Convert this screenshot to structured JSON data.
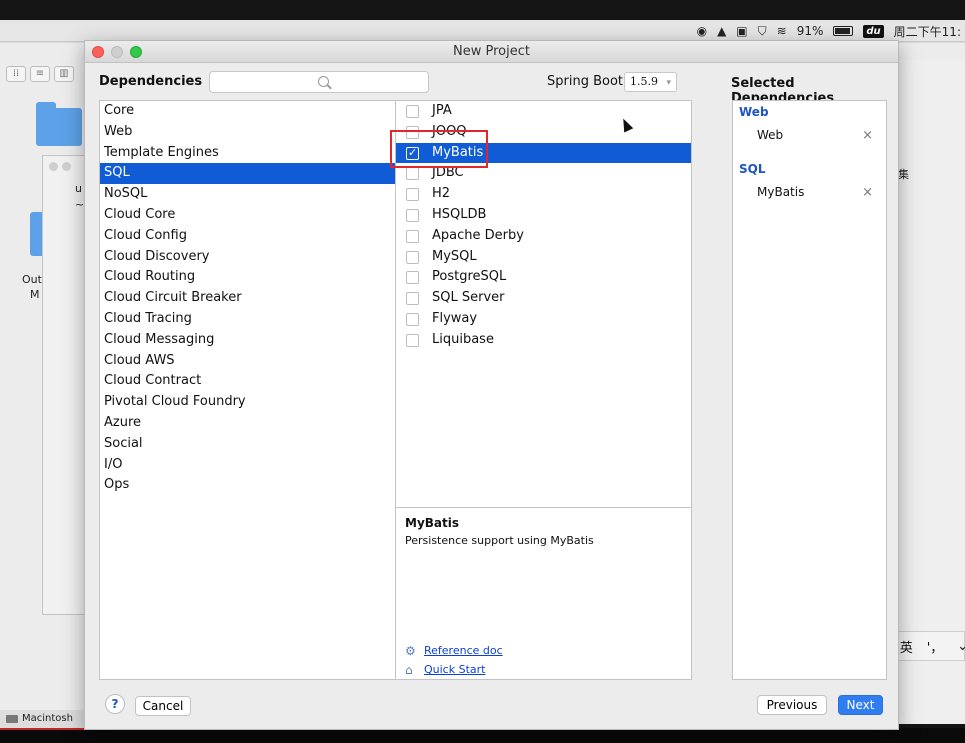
{
  "menubar": {
    "battery": "91%",
    "ime_badge": "du",
    "clock": "周二下午11:"
  },
  "desktop": {
    "window_text_1": "u",
    "window_text_2": "~",
    "folder_label_1": "Out",
    "folder_label_2": "M",
    "right_text": "集",
    "dock_label": "Macintosh",
    "ime_logo": "du",
    "ime_lang": "英",
    "ime_punct": "'，",
    "ime_extra": "⌄"
  },
  "dialog": {
    "title": "New Project",
    "dependencies_title": "Dependencies",
    "search_placeholder": "",
    "spring_boot_label": "Spring Boot",
    "spring_boot_version": "1.5.9",
    "selected_title": "Selected Dependencies",
    "categories": [
      "Core",
      "Web",
      "Template Engines",
      "SQL",
      "NoSQL",
      "Cloud Core",
      "Cloud Config",
      "Cloud Discovery",
      "Cloud Routing",
      "Cloud Circuit Breaker",
      "Cloud Tracing",
      "Cloud Messaging",
      "Cloud AWS",
      "Cloud Contract",
      "Pivotal Cloud Foundry",
      "Azure",
      "Social",
      "I/O",
      "Ops"
    ],
    "selected_category": "SQL",
    "dependencies": [
      {
        "label": "JPA",
        "checked": false
      },
      {
        "label": "JOOQ",
        "checked": false
      },
      {
        "label": "MyBatis",
        "checked": true
      },
      {
        "label": "JDBC",
        "checked": false
      },
      {
        "label": "H2",
        "checked": false
      },
      {
        "label": "HSQLDB",
        "checked": false
      },
      {
        "label": "Apache Derby",
        "checked": false
      },
      {
        "label": "MySQL",
        "checked": false
      },
      {
        "label": "PostgreSQL",
        "checked": false
      },
      {
        "label": "SQL Server",
        "checked": false
      },
      {
        "label": "Flyway",
        "checked": false
      },
      {
        "label": "Liquibase",
        "checked": false
      }
    ],
    "description": {
      "name": "MyBatis",
      "text": "Persistence support using MyBatis",
      "reference_link": "Reference doc",
      "quickstart_link": "Quick Start"
    },
    "selected": [
      {
        "group": "Web",
        "items": [
          "Web"
        ]
      },
      {
        "group": "SQL",
        "items": [
          "MyBatis"
        ]
      }
    ],
    "remove_glyph": "×",
    "buttons": {
      "help": "?",
      "cancel": "Cancel",
      "previous": "Previous",
      "next": "Next"
    }
  },
  "colors": {
    "selection_blue": "#0f5cd6",
    "highlight_red": "#e0272b",
    "next_button": "#2f7df0"
  }
}
